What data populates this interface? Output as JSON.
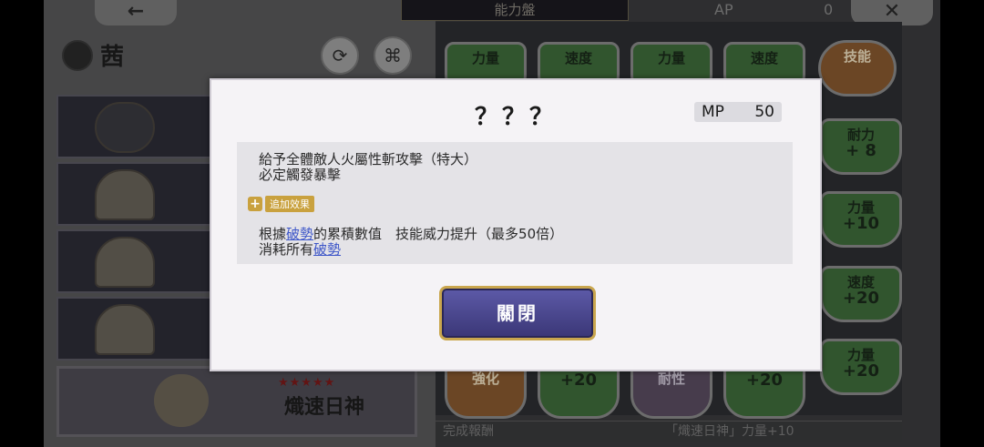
{
  "header": {
    "back_icon": "arrow-left",
    "tab_title": "能力盤",
    "ap_label": "AP",
    "ap_value": "0",
    "close_icon": "x"
  },
  "character": {
    "name": "茜",
    "element_icon": "leaf-icon",
    "buttons": [
      "refresh-icon",
      "formation-icon"
    ]
  },
  "unit_list": {
    "selected": {
      "stars": "★★★★★",
      "name": "熾速日神"
    }
  },
  "board": {
    "nodes": [
      {
        "label": "力量",
        "value": "",
        "style": "green"
      },
      {
        "label": "速度",
        "value": "",
        "style": "green"
      },
      {
        "label": "力量",
        "value": "",
        "style": "green"
      },
      {
        "label": "速度",
        "value": "",
        "style": "green"
      },
      {
        "label": "技能",
        "value": "",
        "style": "orange"
      },
      {
        "label": "耐力",
        "value": "+ 8",
        "style": "green"
      },
      {
        "label": "力量",
        "value": "+10",
        "style": "green"
      },
      {
        "label": "速度",
        "value": "+20",
        "style": "green"
      },
      {
        "label": "力量",
        "value": "+20",
        "style": "green"
      },
      {
        "label": "強化",
        "value": "",
        "style": "orange"
      },
      {
        "label": "",
        "value": "+20",
        "style": "green"
      },
      {
        "label": "耐性",
        "value": "",
        "style": "purple"
      },
      {
        "label": "",
        "value": "+20",
        "style": "green"
      }
    ],
    "footer_left": "完成報酬",
    "footer_right": "「熾速日神」力量+10"
  },
  "dialog": {
    "title": "？？？",
    "mp_label": "MP",
    "mp_value": "50",
    "desc_line1": "給予全體敵人火屬性斬攻擊（特大）",
    "desc_line2": "必定觸發暴擊",
    "badge_label": "追加效果",
    "effect_prefix": "根據",
    "effect_keyword": "破勢",
    "effect_suffix": "的累積數值　技能威力提升（最多50倍）",
    "consume_prefix": "消耗所有",
    "consume_keyword": "破勢",
    "close_label": "關閉"
  }
}
